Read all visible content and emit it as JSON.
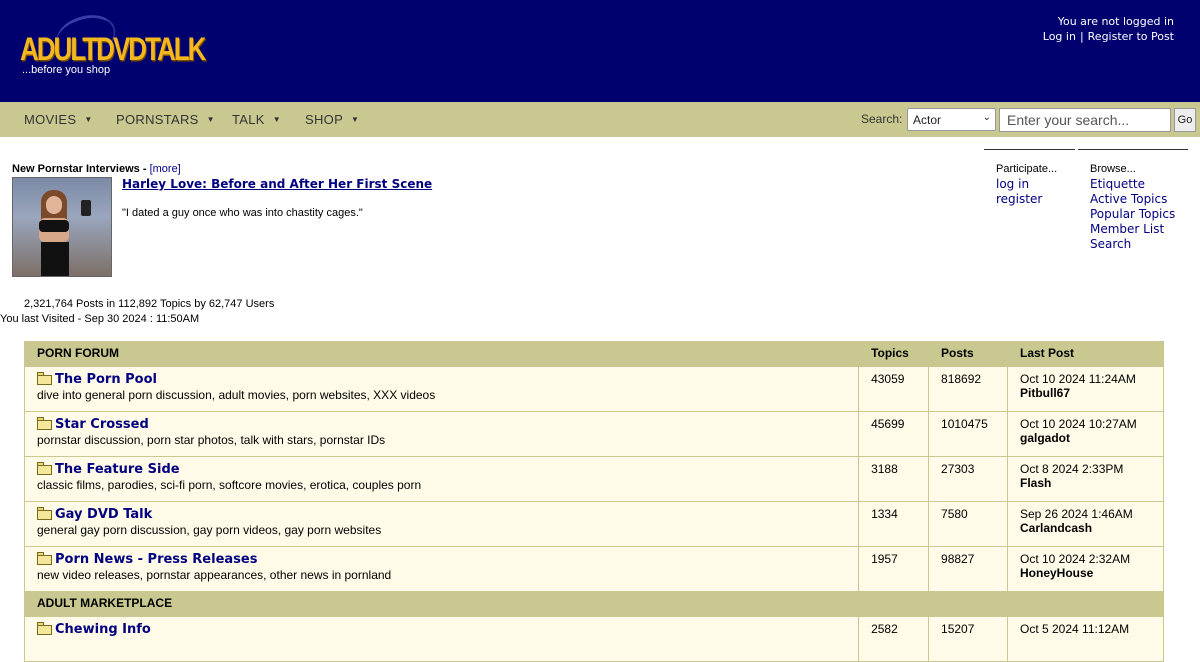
{
  "header": {
    "logo_text": "ADULTDVDTALK",
    "tagline": "...before you shop",
    "login_status": "You are not logged in",
    "login_link": "Log in",
    "register_link": "Register to Post",
    "background_color": "#00006e"
  },
  "nav": {
    "items": [
      {
        "label": "MOVIES"
      },
      {
        "label": "PORNSTARS"
      },
      {
        "label": "TALK"
      },
      {
        "label": "SHOP"
      }
    ],
    "caret_icon": "caret-down-icon",
    "search_label": "Search:",
    "search_type_selected": "Actor",
    "search_placeholder": "Enter your search...",
    "search_button": "Go",
    "background_color": "#c8c890"
  },
  "interview": {
    "heading": "New Pornstar Interviews",
    "heading_sep": " - ",
    "more_link": "[more]",
    "title": "Harley Love: Before and After Her First Scene",
    "quote": "\"I dated a guy once who was into chastity cages.\""
  },
  "participate": {
    "label": "Participate...",
    "links": [
      "log in",
      "register"
    ]
  },
  "browse": {
    "label": "Browse...",
    "links": [
      "Etiquette",
      "Active Topics",
      "Popular Topics",
      "Member List",
      "Search"
    ]
  },
  "stats": {
    "summary": "2,321,764 Posts in 112,892 Topics by 62,747 Users",
    "last_visited": "You last Visited - Sep 30 2024 : 11:50AM"
  },
  "forum_table": {
    "columns": [
      "PORN FORUM",
      "Topics",
      "Posts",
      "Last Post"
    ],
    "rows": [
      {
        "name": "The Porn Pool",
        "desc": "dive into general porn discussion, adult movies, porn websites, XXX videos",
        "topics": "43059",
        "posts": "818692",
        "last_date": "Oct 10 2024 11:24AM",
        "last_user": "Pitbull67"
      },
      {
        "name": "Star Crossed",
        "desc": "pornstar discussion, porn star photos, talk with stars, pornstar IDs",
        "topics": "45699",
        "posts": "1010475",
        "last_date": "Oct 10 2024 10:27AM",
        "last_user": "galgadot"
      },
      {
        "name": "The Feature Side",
        "desc": "classic films, parodies, sci-fi porn, softcore movies, erotica, couples porn",
        "topics": "3188",
        "posts": "27303",
        "last_date": "Oct 8 2024 2:33PM",
        "last_user": "Flash"
      },
      {
        "name": "Gay DVD Talk",
        "desc": "general gay porn discussion, gay porn videos, gay porn websites",
        "topics": "1334",
        "posts": "7580",
        "last_date": "Sep 26 2024 1:46AM",
        "last_user": "Carlandcash"
      },
      {
        "name": "Porn News - Press Releases",
        "desc": "new video releases, pornstar appearances, other news in pornland",
        "topics": "1957",
        "posts": "98827",
        "last_date": "Oct 10 2024 2:32AM",
        "last_user": "HoneyHouse"
      }
    ],
    "category2": "ADULT MARKETPLACE",
    "partial_row": {
      "name": "Chewing Info",
      "topics": "2582",
      "posts": "15207",
      "last_date": "Oct 5 2024 11:12AM"
    }
  }
}
